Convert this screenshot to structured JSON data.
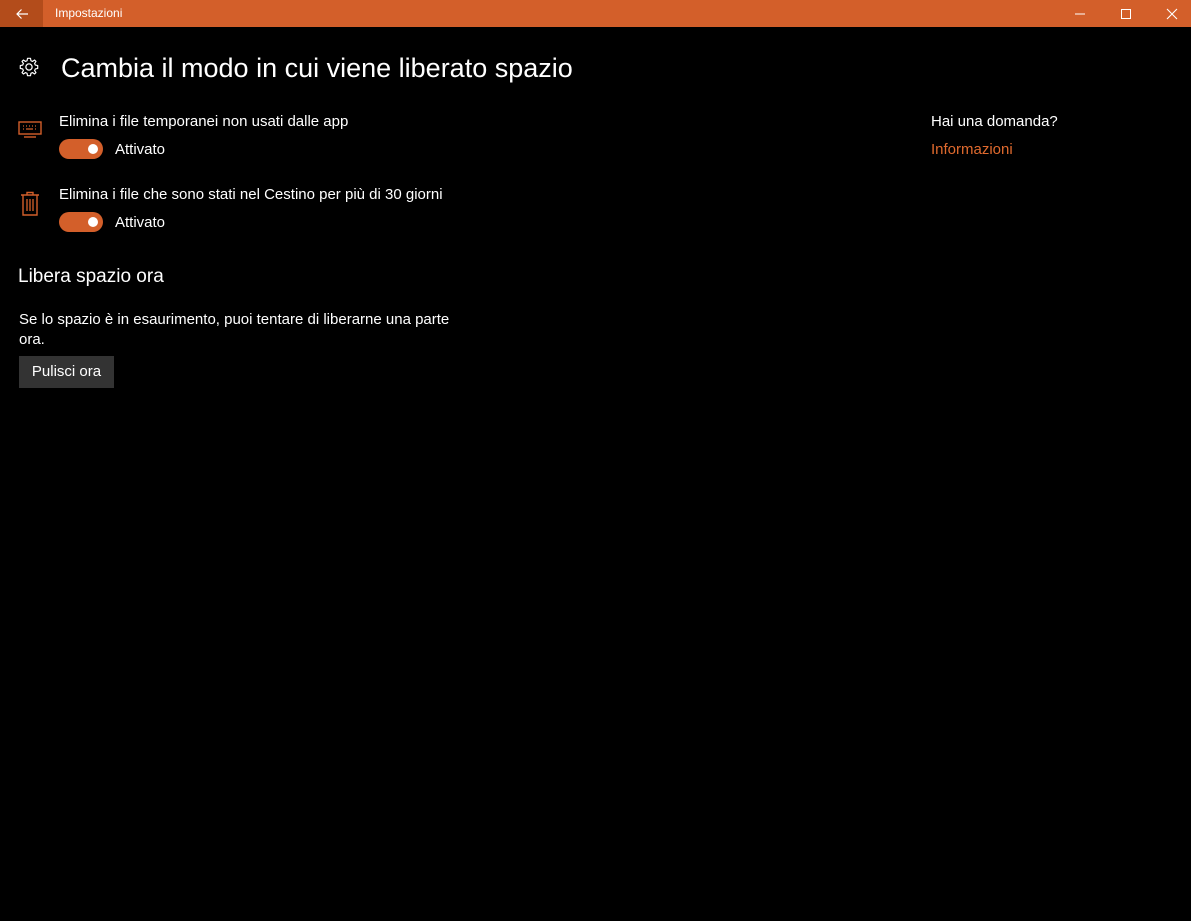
{
  "window": {
    "title": "Impostazioni",
    "back_icon": "arrow-left-icon",
    "controls": [
      "minimize-icon",
      "maximize-icon",
      "close-icon"
    ]
  },
  "colors": {
    "accent": "#d35f2a",
    "accent_dark": "#b34c1b",
    "link": "#e06a2e",
    "background": "#000000",
    "button": "#333333"
  },
  "page": {
    "icon": "gear-icon",
    "title": "Cambia il modo in cui viene liberato spazio"
  },
  "settings": [
    {
      "icon": "keyboard-monitor-icon",
      "label": "Elimina i file temporanei non usati dalle app",
      "state": "Attivato",
      "on": true
    },
    {
      "icon": "trash-bin-icon",
      "label": "Elimina i file che sono stati nel Cestino per più di 30 giorni",
      "state": "Attivato",
      "on": true
    }
  ],
  "free_now": {
    "title": "Libera spazio ora",
    "description": "Se lo spazio è in esaurimento, puoi tentare di liberarne una parte ora.",
    "button_label": "Pulisci ora"
  },
  "help": {
    "title": "Hai una domanda?",
    "link": "Informazioni"
  }
}
